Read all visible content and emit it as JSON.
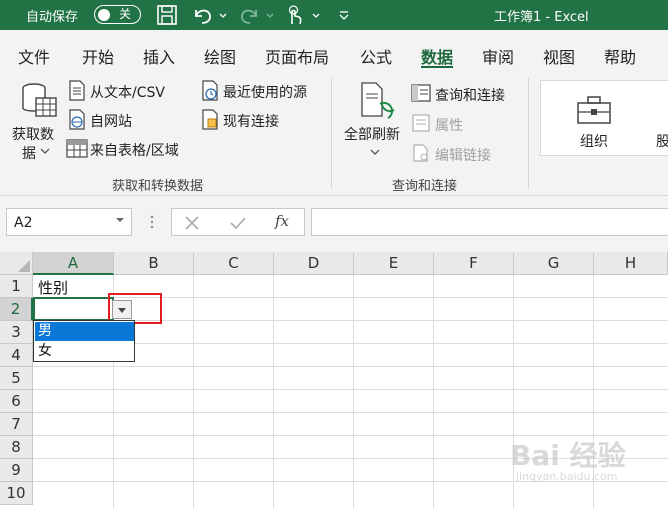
{
  "titlebar": {
    "autosave_label": "自动保存",
    "autosave_state": "关",
    "doc_title": "工作簿1  -  Excel"
  },
  "tabs": [
    "文件",
    "开始",
    "插入",
    "绘图",
    "页面布局",
    "公式",
    "数据",
    "审阅",
    "视图",
    "帮助"
  ],
  "active_tab": "数据",
  "ribbon": {
    "get_data": [
      "获取数",
      "据"
    ],
    "from_text": "从文本/CSV",
    "from_web": "自网站",
    "from_table": "来自表格/区域",
    "recent_sources": "最近使用的源",
    "existing_conn": "现有连接",
    "group1_label": "获取和转换数据",
    "refresh_all": "全部刷新",
    "queries_conn": "查询和连接",
    "properties": "属性",
    "edit_links": "编辑链接",
    "group2_label": "查询和连接",
    "org": "组织",
    "cut_off": "股"
  },
  "formula_bar": {
    "name_box": "A2",
    "fx": "fx",
    "formula": ""
  },
  "grid": {
    "columns": [
      "A",
      "B",
      "C",
      "D",
      "E",
      "F",
      "G",
      "H"
    ],
    "rows": [
      "1",
      "2",
      "3",
      "4",
      "5",
      "6",
      "7",
      "8",
      "9",
      "10"
    ],
    "a1": "性别",
    "dropdown_options": [
      "男",
      "女"
    ],
    "highlighted_option": "男"
  },
  "watermark": {
    "main": "Bai 经验",
    "sub": "jingyan.baidu.com"
  },
  "colors": {
    "excel_green": "#217346",
    "highlight": "#0b78d7",
    "annotation_red": "#e02020"
  }
}
